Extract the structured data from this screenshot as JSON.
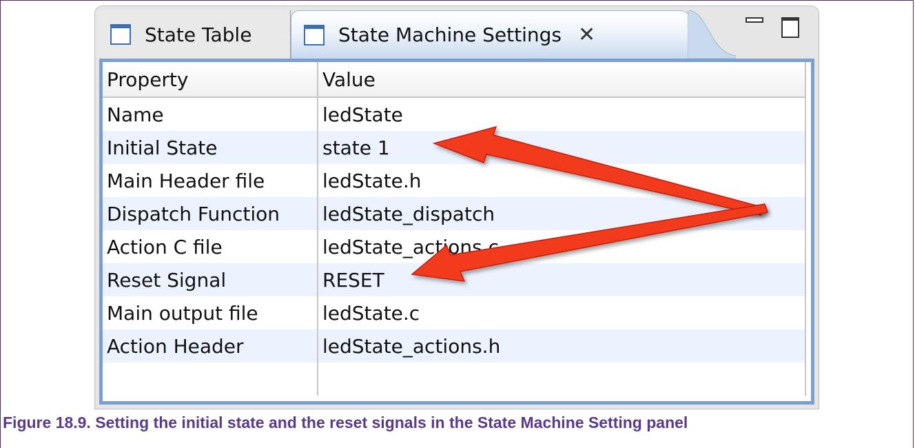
{
  "tabs": [
    {
      "label": "State Table",
      "active": false
    },
    {
      "label": "State Machine Settings",
      "active": true
    }
  ],
  "icons": {
    "tab_icon": "view-icon",
    "close": "close-icon",
    "minimize": "minimize-icon",
    "maximize": "maximize-icon"
  },
  "table": {
    "headers": [
      "Property",
      "Value"
    ],
    "rows": [
      {
        "property": "Name",
        "value": "ledState"
      },
      {
        "property": "Initial State",
        "value": "state 1"
      },
      {
        "property": "Main Header file",
        "value": "ledState.h"
      },
      {
        "property": "Dispatch Function",
        "value": "ledState_dispatch"
      },
      {
        "property": "Action C file",
        "value": "ledState_actions.c"
      },
      {
        "property": "Reset Signal",
        "value": "RESET"
      },
      {
        "property": "Main output file",
        "value": "ledState.c"
      },
      {
        "property": "Action Header",
        "value": "ledState_actions.h"
      },
      {
        "property": "",
        "value": ""
      }
    ]
  },
  "caption": "Figure 18.9. Setting the initial state and the reset signals in the State Machine Setting panel",
  "colors": {
    "accent": "#7c9fd2",
    "row_alt": "#edf3fe",
    "arrow": "#f23a1e",
    "caption": "#5a3a8a"
  }
}
